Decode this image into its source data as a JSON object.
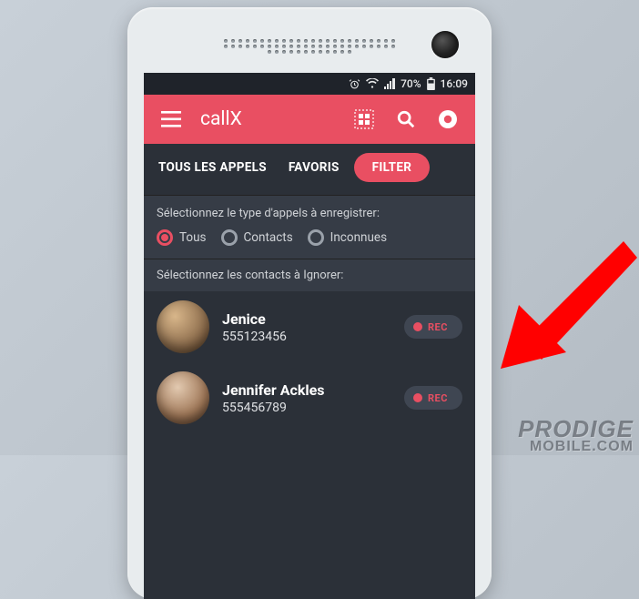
{
  "statusbar": {
    "battery": "70%",
    "time": "16:09"
  },
  "appbar": {
    "title": "callX"
  },
  "tabs": {
    "all": "TOUS LES APPELS",
    "fav": "FAVORIS",
    "filter": "FILTER"
  },
  "filter": {
    "type_label": "Sélectionnez le type d'appels à enregistrer:",
    "options": {
      "all": "Tous",
      "contacts": "Contacts",
      "unknown": "Inconnues"
    },
    "ignore_label": "Sélectionnez les contacts à Ignorer:"
  },
  "contacts": [
    {
      "name": "Jenice",
      "number": "555123456",
      "rec_label": "REC"
    },
    {
      "name": "Jennifer Ackles",
      "number": "555456789",
      "rec_label": "REC"
    }
  ],
  "watermark": {
    "l1": "PRODIGE",
    "l2": "MOBILE.COM"
  },
  "colors": {
    "accent": "#e94f62",
    "panel": "#2b3038",
    "panel_light": "#363c46"
  }
}
